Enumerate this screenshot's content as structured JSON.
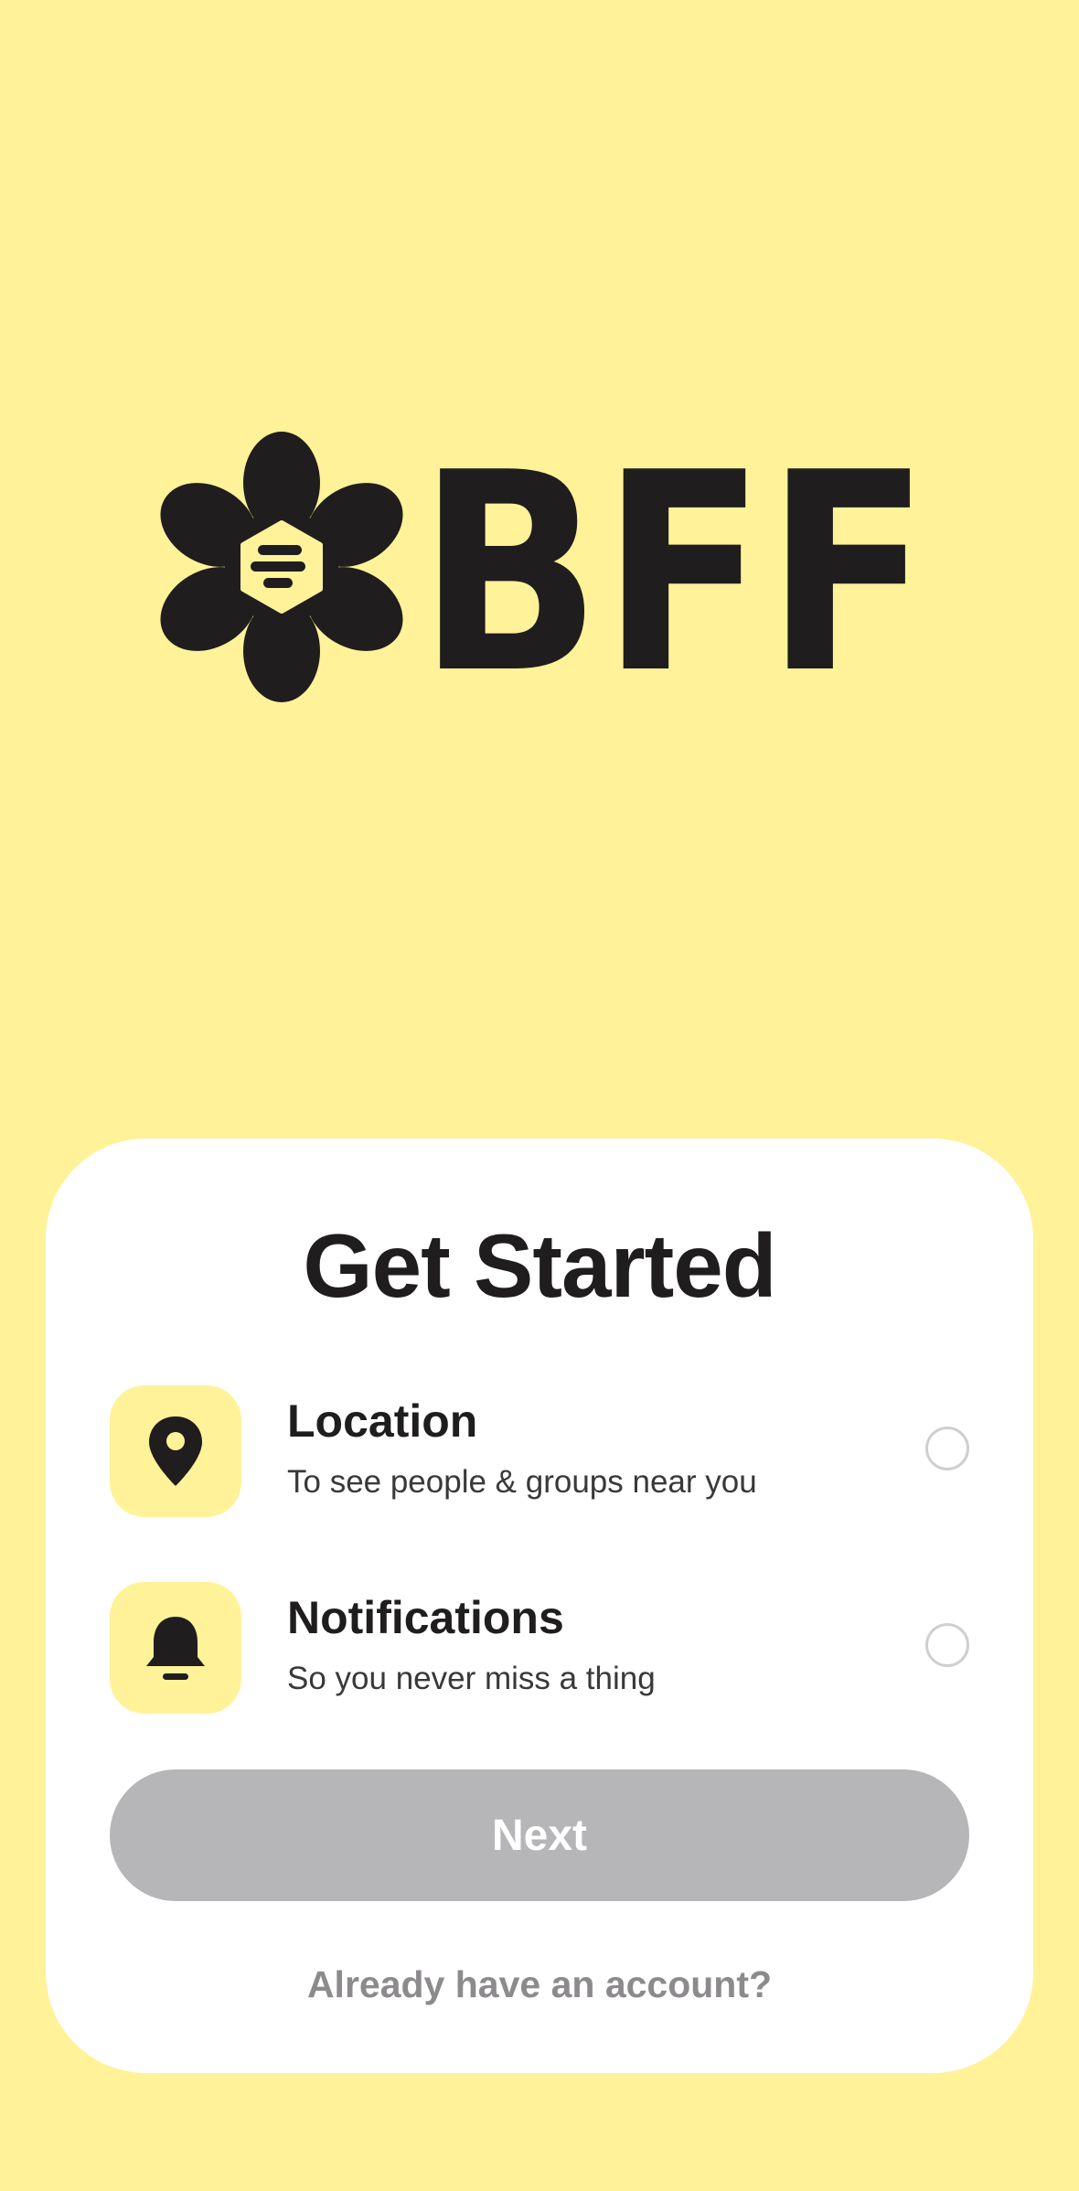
{
  "brand": {
    "logo_text": "BFF",
    "background_color": "#FFF299",
    "ink_color": "#1F1D1D"
  },
  "card": {
    "title": "Get Started",
    "permissions": [
      {
        "icon": "location-pin-icon",
        "title": "Location",
        "subtitle": "To see people & groups near you",
        "selected": false
      },
      {
        "icon": "bell-icon",
        "title": "Notifications",
        "subtitle": "So you never miss a thing",
        "selected": false
      }
    ],
    "next_label": "Next",
    "next_button_color": "#B6B5B7",
    "login_link": "Already have an account?"
  }
}
